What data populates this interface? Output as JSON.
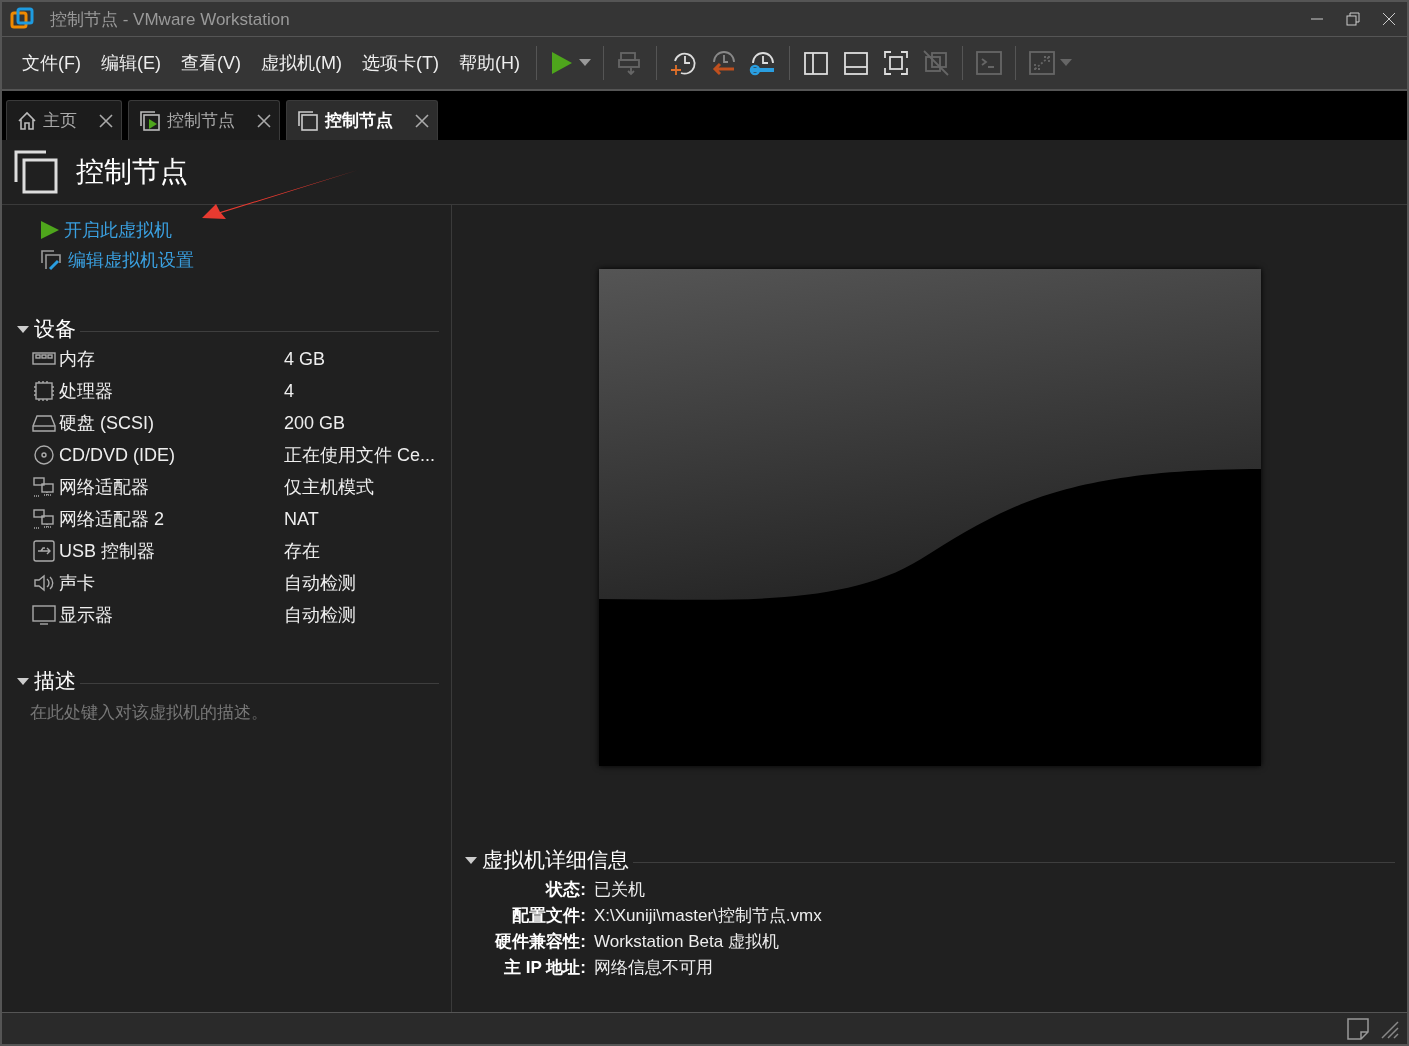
{
  "window": {
    "title": "控制节点 - VMware Workstation"
  },
  "menu": [
    "文件(F)",
    "编辑(E)",
    "查看(V)",
    "虚拟机(M)",
    "选项卡(T)",
    "帮助(H)"
  ],
  "toolbar": [
    {
      "kind": "play",
      "disabled": false,
      "dropdown": true
    },
    {
      "kind": "sep"
    },
    {
      "kind": "send-keys",
      "disabled": true
    },
    {
      "kind": "sep"
    },
    {
      "kind": "snapshot",
      "disabled": false
    },
    {
      "kind": "revert",
      "disabled": false
    },
    {
      "kind": "snapshot-manager",
      "disabled": false
    },
    {
      "kind": "sep"
    },
    {
      "kind": "library",
      "disabled": false
    },
    {
      "kind": "thumbnail",
      "disabled": false
    },
    {
      "kind": "fullscreen",
      "disabled": false
    },
    {
      "kind": "unity",
      "disabled": true
    },
    {
      "kind": "sep"
    },
    {
      "kind": "console",
      "disabled": true
    },
    {
      "kind": "sep"
    },
    {
      "kind": "stretch",
      "disabled": true,
      "dropdown": true
    }
  ],
  "tabs": [
    {
      "label": "主页",
      "kind": "home",
      "selected": false
    },
    {
      "label": "控制节点",
      "kind": "vm-running",
      "selected": false
    },
    {
      "label": "控制节点",
      "kind": "vm",
      "selected": true
    }
  ],
  "vm_title": "控制节点",
  "actions": [
    {
      "label": "开启此虚拟机",
      "kind": "power-on"
    },
    {
      "label": "编辑虚拟机设置",
      "kind": "edit-settings"
    }
  ],
  "devices_section": {
    "title": "设备",
    "expanded": true
  },
  "devices": [
    {
      "kind": "memory",
      "name": "内存",
      "value": "4 GB"
    },
    {
      "kind": "cpu",
      "name": "处理器",
      "value": "4"
    },
    {
      "kind": "disk",
      "name": "硬盘 (SCSI)",
      "value": "200 GB"
    },
    {
      "kind": "cd",
      "name": "CD/DVD (IDE)",
      "value": "正在使用文件 Ce..."
    },
    {
      "kind": "network",
      "name": "网络适配器",
      "value": "仅主机模式"
    },
    {
      "kind": "network",
      "name": "网络适配器 2",
      "value": "NAT"
    },
    {
      "kind": "usb",
      "name": "USB 控制器",
      "value": "存在"
    },
    {
      "kind": "sound",
      "name": "声卡",
      "value": "自动检测"
    },
    {
      "kind": "display",
      "name": "显示器",
      "value": "自动检测"
    }
  ],
  "description_section": {
    "title": "描述",
    "expanded": true,
    "placeholder": "在此处键入对该虚拟机的描述。"
  },
  "details_section": {
    "title": "虚拟机详细信息",
    "expanded": true
  },
  "details": [
    {
      "label": "状态:",
      "value": "已关机"
    },
    {
      "label": "配置文件:",
      "value": "X:\\Xuniji\\master\\控制节点.vmx"
    },
    {
      "label": "硬件兼容性:",
      "value": "Workstation Beta 虚拟机"
    },
    {
      "label": "主 IP 地址:",
      "value": "网络信息不可用"
    }
  ]
}
